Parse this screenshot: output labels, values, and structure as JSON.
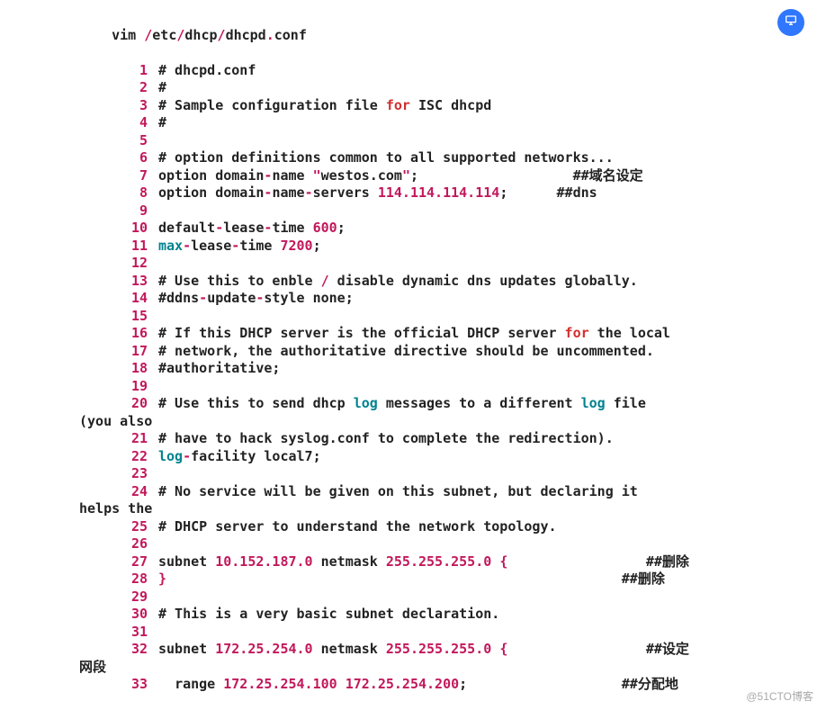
{
  "cmd": {
    "word0": "vim ",
    "path_root": "/",
    "path_seg1": "etc",
    "slash1": "/",
    "path_seg2": "dhcp",
    "slash2": "/",
    "path_file": "dhcpd",
    "dot": ".",
    "path_ext": "conf"
  },
  "lines": {
    "l1": {
      "n": "1",
      "t1": "# dhcpd.conf"
    },
    "l2": {
      "n": "2",
      "t1": "#"
    },
    "l3": {
      "n": "3",
      "t1": "# Sample configuration file ",
      "kw": "for",
      "t2": " ISC dhcpd"
    },
    "l4": {
      "n": "4",
      "t1": "#"
    },
    "l5": {
      "n": "5"
    },
    "l6": {
      "n": "6",
      "t1": "# option definitions common to all supported networks..."
    },
    "l7": {
      "n": "7",
      "t1": "option domain",
      "d1": "-",
      "t2": "name ",
      "q1": "\"",
      "str": "westos.com",
      "q2": "\"",
      "semi": ";",
      "pad": "                   ",
      "cmt": "##域名设定"
    },
    "l8": {
      "n": "8",
      "t1": "option domain",
      "d1": "-",
      "t2": "name",
      "d2": "-",
      "t3": "servers ",
      "ip": "114.114.114.114",
      "semi": ";",
      "pad": "      ",
      "cmt": "##dns"
    },
    "l9": {
      "n": "9"
    },
    "l10": {
      "n": "10",
      "t1": "default",
      "d1": "-",
      "t2": "lease",
      "d2": "-",
      "t3": "time ",
      "num": "600",
      "semi": ";"
    },
    "l11": {
      "n": "11",
      "kw": "max",
      "d1": "-",
      "t2": "lease",
      "d2": "-",
      "t3": "time ",
      "num": "7200",
      "semi": ";"
    },
    "l12": {
      "n": "12"
    },
    "l13": {
      "n": "13",
      "t1": "# Use this to enble ",
      "slash": "/",
      "t2": " disable dynamic dns updates globally."
    },
    "l14": {
      "n": "14",
      "t1": "#ddns",
      "d1": "-",
      "t2": "update",
      "d2": "-",
      "t3": "style none;"
    },
    "l15": {
      "n": "15"
    },
    "l16": {
      "n": "16",
      "t1": "# If this DHCP server is the official DHCP server ",
      "kw": "for",
      "t2": " the local"
    },
    "l17": {
      "n": "17",
      "t1": "# network, the authoritative directive should be uncommented."
    },
    "l18": {
      "n": "18",
      "t1": "#authoritative;"
    },
    "l19": {
      "n": "19"
    },
    "l20": {
      "n": "20",
      "t1": "# Use this to send dhcp ",
      "kw1": "log",
      "t2": " messages to a different ",
      "kw2": "log",
      "t3": " file "
    },
    "wrap20": "(you also",
    "l21": {
      "n": "21",
      "t1": "# have to hack syslog.conf to complete the redirection)."
    },
    "l22": {
      "n": "22",
      "kw": "log",
      "d1": "-",
      "t2": "facility local7;"
    },
    "l23": {
      "n": "23"
    },
    "l24": {
      "n": "24",
      "t1": "# No service will be given on this subnet, but declaring it "
    },
    "wrap24": "helps the",
    "l25": {
      "n": "25",
      "t1": "# DHCP server to understand the network topology."
    },
    "l26": {
      "n": "26"
    },
    "l27": {
      "n": "27",
      "t1": "subnet ",
      "ip1": "10.152.187.0",
      "t2": " netmask ",
      "ip2": "255.255.255.0",
      "t3": " ",
      "br": "{",
      "pad": "                 ",
      "cmt": "##删除"
    },
    "l28": {
      "n": "28",
      "br": "}",
      "pad": "                                                        ",
      "cmt": "##删除"
    },
    "l29": {
      "n": "29"
    },
    "l30": {
      "n": "30",
      "t1": "# This is a very basic subnet declaration."
    },
    "l31": {
      "n": "31"
    },
    "l32": {
      "n": "32",
      "t1": "subnet ",
      "ip1": "172.25.254.0",
      "t2": " netmask ",
      "ip2": "255.255.255.0",
      "t3": " ",
      "br": "{",
      "pad": "                 ",
      "cmt": "##设定"
    },
    "wrap32": "网段",
    "l33": {
      "n": "33",
      "indent": "  ",
      "t1": "range ",
      "ip1": "172.25.254.100",
      "sp": " ",
      "ip2": "172.25.254.200",
      "semi": ";",
      "pad": "                   ",
      "cmt": "##分配地"
    }
  },
  "watermark": "@51CTO博客"
}
